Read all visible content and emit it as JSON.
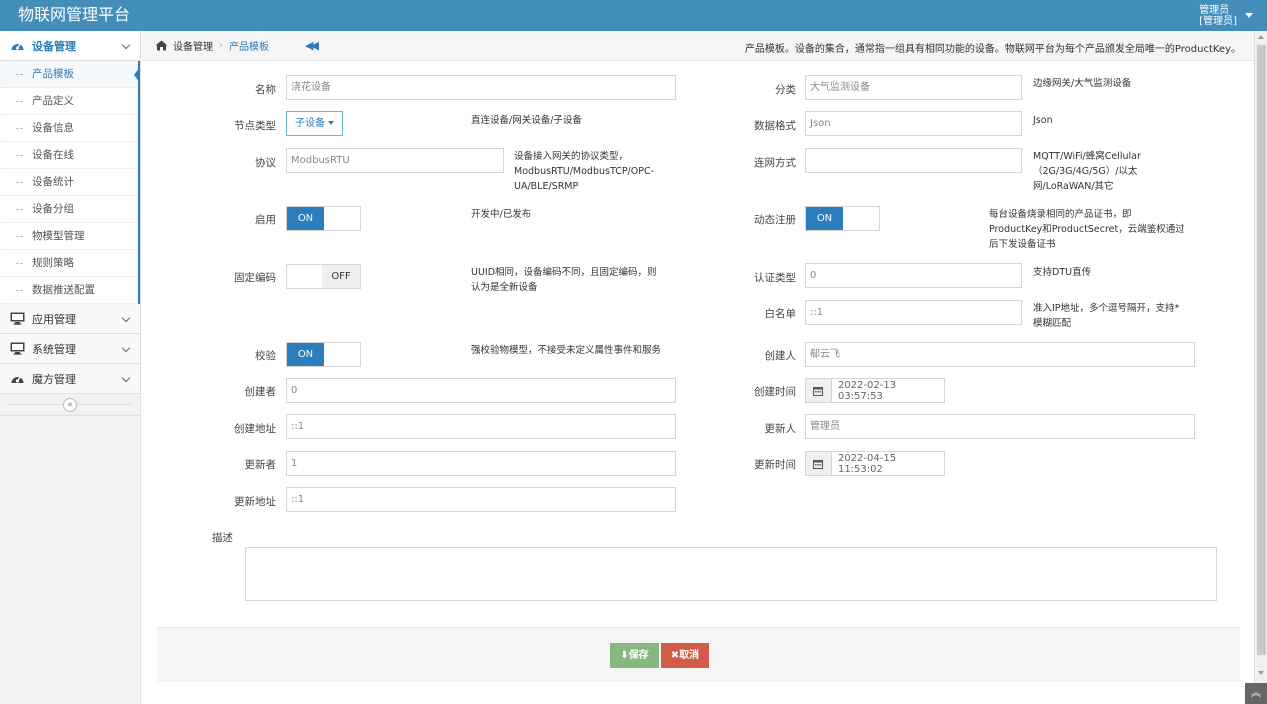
{
  "header": {
    "brand": "物联网管理平台",
    "user_line1": "管理员",
    "user_line2": "[管理员]"
  },
  "sidebar": {
    "groups": [
      {
        "label": "设备管理",
        "icon": "dashboard-icon"
      },
      {
        "label": "应用管理",
        "icon": "desktop-icon"
      },
      {
        "label": "系统管理",
        "icon": "desktop-icon"
      },
      {
        "label": "魔方管理",
        "icon": "dashboard-icon"
      }
    ],
    "sub_items": [
      "产品模板",
      "产品定义",
      "设备信息",
      "设备在线",
      "设备统计",
      "设备分组",
      "物模型管理",
      "规则策略",
      "数据推送配置"
    ],
    "collapse": "«"
  },
  "breadcrumb": {
    "root": "设备管理",
    "current": "产品模板",
    "description": "产品模板。设备的集合，通常指一组具有相同功能的设备。物联网平台为每个产品颁发全局唯一的ProductKey。"
  },
  "form": {
    "name": {
      "label": "名称",
      "value": "浇花设备"
    },
    "category": {
      "label": "分类",
      "value": "大气监测设备",
      "hint": "边缘网关/大气监测设备"
    },
    "node_type": {
      "label": "节点类型",
      "value": "子设备",
      "hint": "直连设备/网关设备/子设备"
    },
    "data_format": {
      "label": "数据格式",
      "value": "Json",
      "hint": "Json"
    },
    "protocol": {
      "label": "协议",
      "value": "ModbusRTU",
      "hint_1": "设备接入网关的协议类型，",
      "hint_2": "ModbusRTU/ModbusTCP/OPC-",
      "hint_3": "UA/BLE/SRMP"
    },
    "network": {
      "label": "连网方式",
      "value": "",
      "hint_1": "MQTT/WiFi/蜂窝Cellular",
      "hint_2": "（2G/3G/4G/5G）/以太",
      "hint_3": "网/LoRaWAN/其它"
    },
    "enabled": {
      "label": "启用",
      "state": "ON",
      "hint": "开发中/已发布"
    },
    "dynamic_register": {
      "label": "动态注册",
      "state": "ON",
      "hint_1": "每台设备烧录相同的产品证书，即",
      "hint_2": "ProductKey和ProductSecret，云端鉴权通过",
      "hint_3": "后下发设备证书"
    },
    "fixed_code": {
      "label": "固定编码",
      "state": "OFF",
      "hint_1": "UUID相同，设备编码不同，且固定编码，则",
      "hint_2": "认为是全新设备"
    },
    "auth_type": {
      "label": "认证类型",
      "value": "0",
      "hint": "支持DTU直传"
    },
    "whitelist": {
      "label": "白名单",
      "value": "::1",
      "hint_1": "准入IP地址，多个逗号隔开，支持*",
      "hint_2": "模糊匹配"
    },
    "validate": {
      "label": "校验",
      "state": "ON",
      "hint": "强校验物模型，不接受未定义属性事件和服务"
    },
    "creator_name": {
      "label": "创建人",
      "value": "郗云飞"
    },
    "creator": {
      "label": "创建者",
      "value": "0"
    },
    "created_time": {
      "label": "创建时间",
      "value": "2022-02-13 03:57:53"
    },
    "created_ip": {
      "label": "创建地址",
      "value": "::1"
    },
    "updater_name": {
      "label": "更新人",
      "value": "管理员"
    },
    "updater": {
      "label": "更新者",
      "value": "1"
    },
    "updated_time": {
      "label": "更新时间",
      "value": "2022-04-15 11:53:02"
    },
    "updated_ip": {
      "label": "更新地址",
      "value": "::1"
    },
    "description": {
      "label": "描述",
      "value": ""
    }
  },
  "actions": {
    "save": "保存",
    "cancel": "取消"
  },
  "colors": {
    "header": "#438eb9",
    "accent": "#2b7dbc",
    "save": "#87b87f",
    "cancel": "#d15b47"
  }
}
